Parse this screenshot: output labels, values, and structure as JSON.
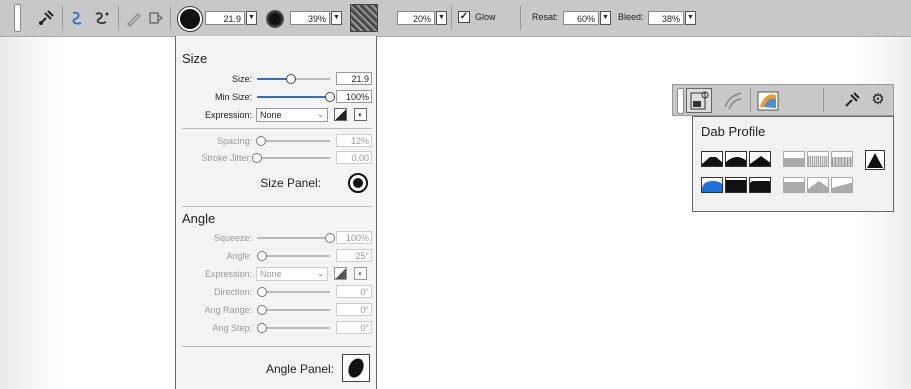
{
  "toolbar": {
    "brush_size": "21.9",
    "opacity": "39%",
    "texture_amount": "20%",
    "glow_label": "Glow",
    "glow_checked": "✓",
    "resat_label": "Resat:",
    "resat_value": "60%",
    "bleed_label": "Bleed:",
    "bleed_value": "38%",
    "icons": [
      "brush-tool-icon",
      "stroke-icon-1",
      "stroke-icon-2",
      "pen-icon",
      "dropper-icon"
    ]
  },
  "size_section": {
    "title": "Size",
    "size_label": "Size:",
    "size_value": "21.9",
    "size_level": 0.47,
    "min_size_label": "Min Size:",
    "min_size_value": "100%",
    "min_size_level": 1.0,
    "expression_label": "Expression:",
    "expression_value": "None",
    "spacing_label": "Spacing:",
    "spacing_value": "12%",
    "spacing_level": 0.05,
    "stroke_jitter_label": "Stroke Jitter:",
    "stroke_jitter_value": "0.00",
    "stroke_jitter_level": 0.0,
    "panel_label": "Size Panel:"
  },
  "angle_section": {
    "title": "Angle",
    "squeeze_label": "Squeeze:",
    "squeeze_value": "100%",
    "squeeze_level": 1.0,
    "angle_label": "Angle:",
    "angle_value": "25°",
    "angle_level": 0.07,
    "expression_label": "Expression:",
    "expression_value": "None",
    "direction_label": "Direction:",
    "direction_value": "0°",
    "ang_range_label": "Ang Range:",
    "ang_range_value": "0°",
    "ang_step_label": "Ang Step:",
    "ang_step_value": "0°",
    "panel_label": "Angle Panel:"
  },
  "dab_profile": {
    "title": "Dab Profile",
    "selected_index": 0
  },
  "colors": {
    "accent": "#2d6fc1",
    "toolbar_bg": "#c8c8c8",
    "selected_dab": "#1a73d9"
  }
}
